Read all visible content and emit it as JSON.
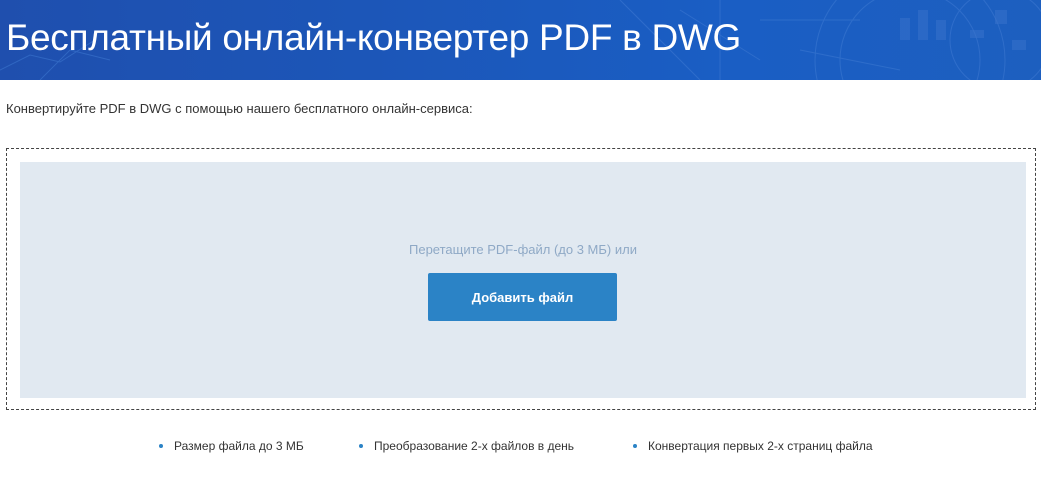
{
  "header": {
    "title": "Бесплатный онлайн-конвертер PDF в DWG"
  },
  "intro_text": "Конвертируйте PDF в DWG с помощью нашего бесплатного онлайн-сервиса:",
  "dropzone": {
    "hint": "Перетащите PDF-файл (до 3 МБ) или",
    "button_label": "Добавить файл"
  },
  "features": [
    {
      "label": "Размер файла до 3 МБ"
    },
    {
      "label": "Преобразование 2-х файлов в день"
    },
    {
      "label": "Конвертация первых 2-х страниц файла"
    }
  ],
  "colors": {
    "banner": "#1c56b8",
    "accent": "#2b83c6",
    "dropzone_bg": "#e1e9f1",
    "hint_text": "#8fa9c6"
  },
  "icons": {
    "feature_bullet": "bullet-dot-icon"
  }
}
